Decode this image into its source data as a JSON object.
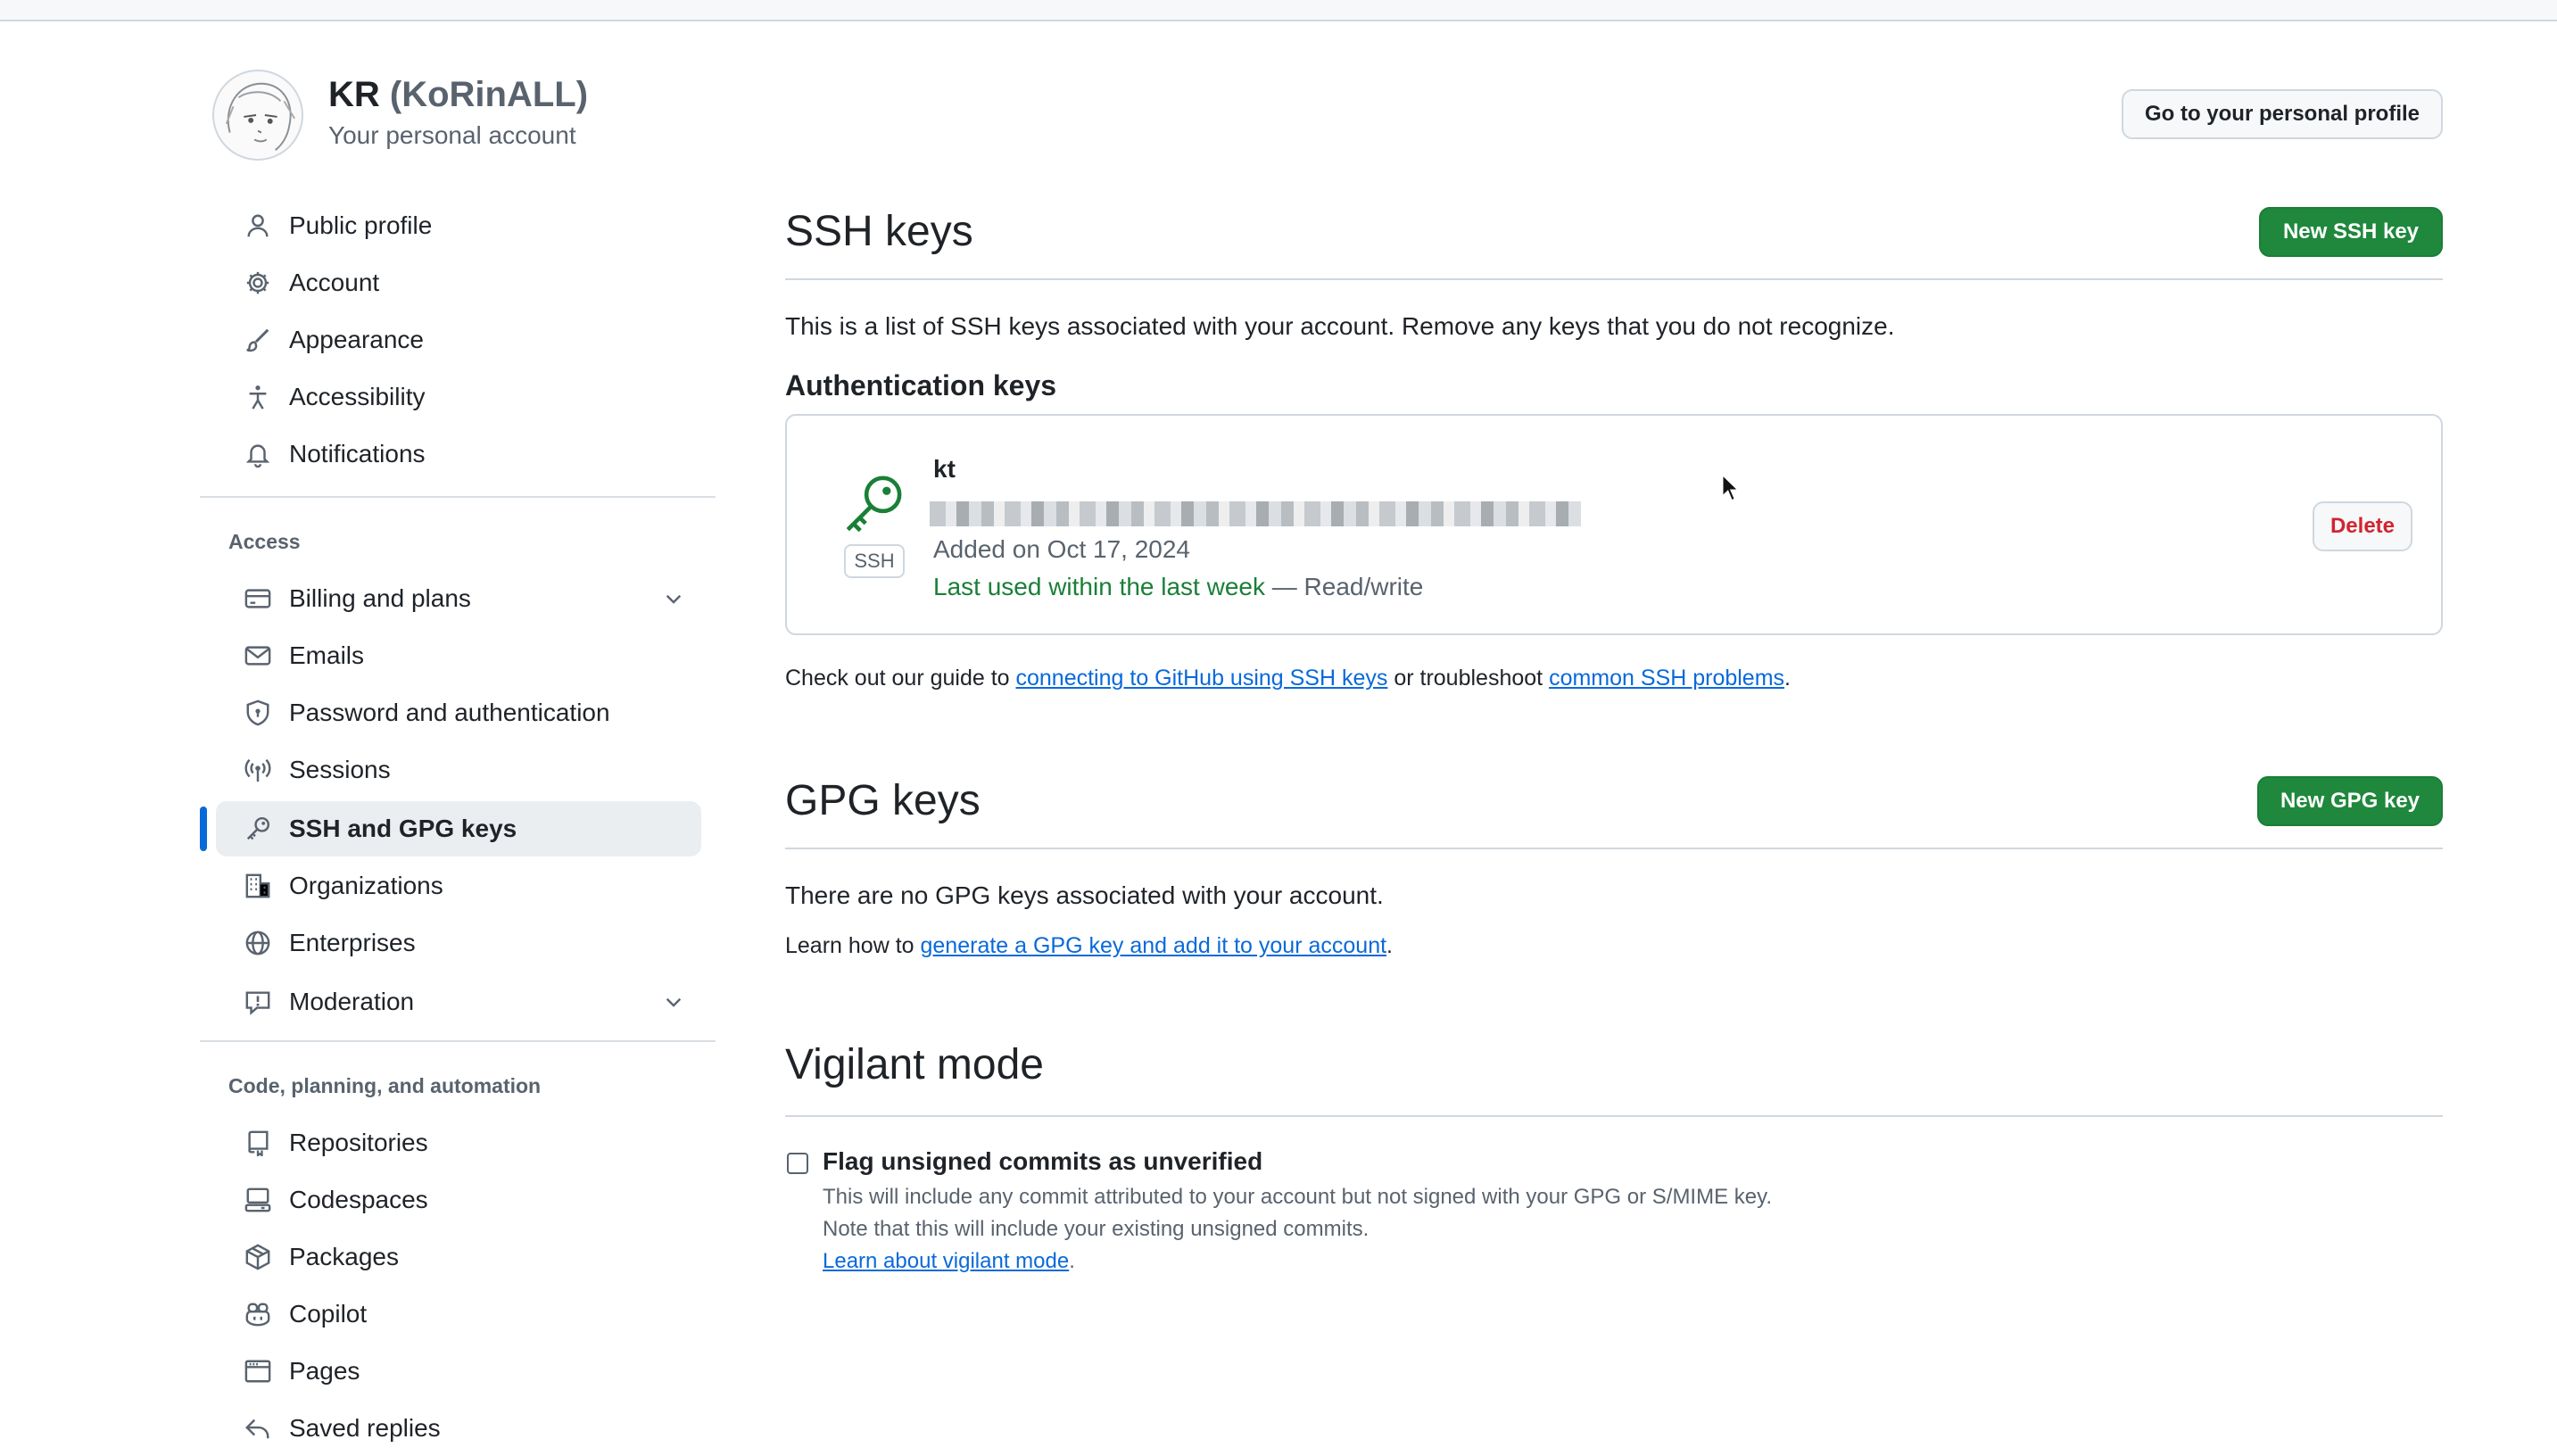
{
  "account": {
    "name": "KR",
    "login": "(KoRinALL)",
    "subtitle": "Your personal account",
    "profile_button": "Go to your personal profile"
  },
  "sidebar": {
    "items_top": [
      {
        "label": "Public profile",
        "icon": "person-icon"
      },
      {
        "label": "Account",
        "icon": "gear-icon"
      },
      {
        "label": "Appearance",
        "icon": "paintbrush-icon"
      },
      {
        "label": "Accessibility",
        "icon": "accessibility-icon"
      },
      {
        "label": "Notifications",
        "icon": "bell-icon"
      }
    ],
    "access_heading": "Access",
    "items_access": [
      {
        "label": "Billing and plans",
        "icon": "credit-card-icon"
      },
      {
        "label": "Emails",
        "icon": "mail-icon"
      },
      {
        "label": "Password and authentication",
        "icon": "shield-lock-icon"
      },
      {
        "label": "Sessions",
        "icon": "broadcast-icon"
      },
      {
        "label": "SSH and GPG keys",
        "icon": "key-icon"
      },
      {
        "label": "Organizations",
        "icon": "organization-icon"
      },
      {
        "label": "Enterprises",
        "icon": "globe-icon"
      },
      {
        "label": "Moderation",
        "icon": "report-icon"
      }
    ],
    "code_heading": "Code, planning, and automation",
    "items_code": [
      {
        "label": "Repositories",
        "icon": "repo-icon"
      },
      {
        "label": "Codespaces",
        "icon": "codespaces-icon"
      },
      {
        "label": "Packages",
        "icon": "package-icon"
      },
      {
        "label": "Copilot",
        "icon": "copilot-icon"
      },
      {
        "label": "Pages",
        "icon": "browser-icon"
      },
      {
        "label": "Saved replies",
        "icon": "reply-icon"
      }
    ]
  },
  "ssh": {
    "title": "SSH keys",
    "new_button": "New SSH key",
    "description": "This is a list of SSH keys associated with your account. Remove any keys that you do not recognize.",
    "auth_heading": "Authentication keys",
    "key": {
      "badge": "SSH",
      "title": "kt",
      "added": "Added on Oct 17, 2024",
      "last_used": "Last used within the last week",
      "access": " — Read/write",
      "delete_button": "Delete"
    },
    "guide_prefix": "Check out our guide to ",
    "guide_link1": "connecting to GitHub using SSH keys",
    "guide_middle": " or troubleshoot ",
    "guide_link2": "common SSH problems",
    "guide_suffix": "."
  },
  "gpg": {
    "title": "GPG keys",
    "new_button": "New GPG key",
    "empty_text": "There are no GPG keys associated with your account.",
    "learn_prefix": "Learn how to ",
    "learn_link": "generate a GPG key and add it to your account",
    "learn_suffix": "."
  },
  "vigilant": {
    "title": "Vigilant mode",
    "checkbox_label": "Flag unsigned commits as unverified",
    "checked": false,
    "note1": "This will include any commit attributed to your account but not signed with your GPG or S/MIME key.",
    "note2": "Note that this will include your existing unsigned commits.",
    "learn_link": "Learn about vigilant mode",
    "learn_suffix": "."
  },
  "colors": {
    "accent": "#0969da",
    "primary_button": "#1f883d",
    "danger": "#d1242f",
    "success_text": "#1a7f37"
  }
}
